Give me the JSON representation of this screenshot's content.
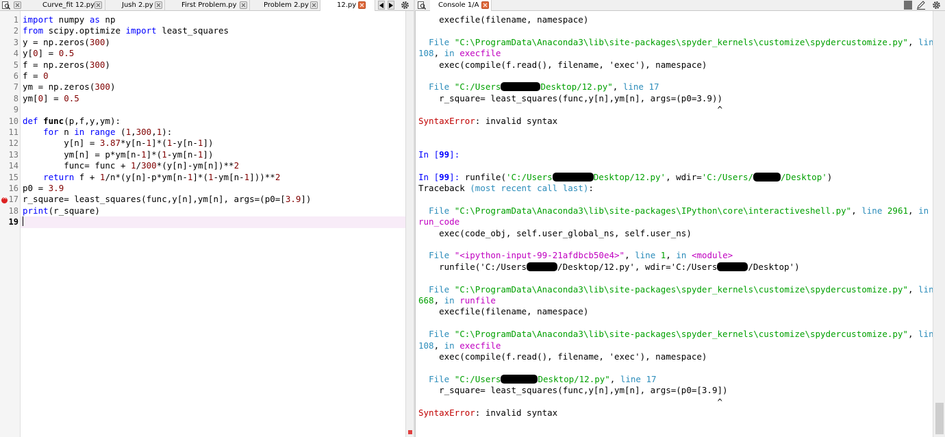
{
  "editor_tabs": [
    {
      "label": "Curve_fit 12.py",
      "active": false
    },
    {
      "label": "Jush 2.py",
      "active": false
    },
    {
      "label": "First Problem.py",
      "active": false
    },
    {
      "label": "Problem 2.py",
      "active": false
    },
    {
      "label": "12.py",
      "active": true
    }
  ],
  "console_tab": {
    "label": "Console 1/A"
  },
  "icons": {
    "browse_tabs": "search-doc-icon",
    "scroll_left": "arrow-left-icon",
    "scroll_right": "arrow-right-icon",
    "options": "gear-icon",
    "stop": "square-stop-icon",
    "edit": "pencil-icon"
  },
  "colors": {
    "keyword": "#0000ff",
    "number": "#800000",
    "file_path": "#00a000",
    "traceback_link": "#c000c0",
    "error_marker": "#d22222",
    "current_line": "#f8ecf8"
  },
  "editor": {
    "line_numbers": [
      "1",
      "2",
      "3",
      "4",
      "5",
      "6",
      "7",
      "8",
      "9",
      "10",
      "11",
      "12",
      "13",
      "14",
      "15",
      "16",
      "17",
      "18",
      "19"
    ],
    "error_line": "17",
    "current_line": "19",
    "lines": [
      "import numpy as np",
      "from scipy.optimize import least_squares",
      "y = np.zeros(300)",
      "y[0] = 0.5",
      "f = np.zeros(300)",
      "f = 0",
      "ym = np.zeros(300)",
      "ym[0] = 0.5",
      "",
      "def func(p,f,y,ym):",
      "    for n in range (1,300,1):",
      "        y[n] = 3.87*y[n-1]*(1-y[n-1])",
      "        ym[n] = p*ym[n-1]*(1-ym[n-1])",
      "        func= func + 1/300*(y[n]-ym[n])**2",
      "    return f + 1/n*(y[n]-p*ym[n-1]*(1-ym[n-1]))**2",
      "p0 = 3.9",
      "r_square= least_squares(func,y[n],ym[n], args=(p0=[3.9])",
      "print(r_square)",
      ""
    ]
  },
  "console": {
    "lines": [
      {
        "text": "    execfile(filename, namespace)"
      },
      {
        "text": ""
      },
      {
        "text": "  File \"C:\\ProgramData\\Anaconda3\\lib\\site-packages\\spyder_kernels\\customize\\spydercustomize.py\", line"
      },
      {
        "text": "108, in execfile"
      },
      {
        "text": "    exec(compile(f.read(), filename, 'exec'), namespace)"
      },
      {
        "text": ""
      },
      {
        "text": "  File \"C:/Users/Desktop/12.py\", line 17"
      },
      {
        "text": "    r_square= least_squares(func,y[n],ym[n], args=(p0=3.9))"
      },
      {
        "text": "                                                          ^"
      },
      {
        "text": "SyntaxError: invalid syntax"
      },
      {
        "text": ""
      },
      {
        "text": ""
      },
      {
        "text": "In [99]:"
      },
      {
        "text": ""
      },
      {
        "text": "In [99]: runfile('C:/Users/Desktop/12.py', wdir='C:/Users/Desktop')"
      },
      {
        "text": "Traceback (most recent call last):"
      },
      {
        "text": ""
      },
      {
        "text": "  File \"C:\\ProgramData\\Anaconda3\\lib\\site-packages\\IPython\\core\\interactiveshell.py\", line 2961, in"
      },
      {
        "text": "run_code"
      },
      {
        "text": "    exec(code_obj, self.user_global_ns, self.user_ns)"
      },
      {
        "text": ""
      },
      {
        "text": "  File \"<ipython-input-99-21afdbcb50e4>\", line 1, in <module>"
      },
      {
        "text": "    runfile('C:/Users/Desktop/12.py', wdir='C:/Users/Desktop')"
      },
      {
        "text": ""
      },
      {
        "text": "  File \"C:\\ProgramData\\Anaconda3\\lib\\site-packages\\spyder_kernels\\customize\\spydercustomize.py\", line"
      },
      {
        "text": "668, in runfile"
      },
      {
        "text": "    execfile(filename, namespace)"
      },
      {
        "text": ""
      },
      {
        "text": "  File \"C:\\ProgramData\\Anaconda3\\lib\\site-packages\\spyder_kernels\\customize\\spydercustomize.py\", line"
      },
      {
        "text": "108, in execfile"
      },
      {
        "text": "    exec(compile(f.read(), filename, 'exec'), namespace)"
      },
      {
        "text": ""
      },
      {
        "text": "  File \"C:/Users/Desktop/12.py\", line 17"
      },
      {
        "text": "    r_square= least_squares(func,y[n],ym[n], args=(p0=[3.9])"
      },
      {
        "text": "                                                          ^"
      },
      {
        "text": "SyntaxError: invalid syntax"
      }
    ]
  }
}
